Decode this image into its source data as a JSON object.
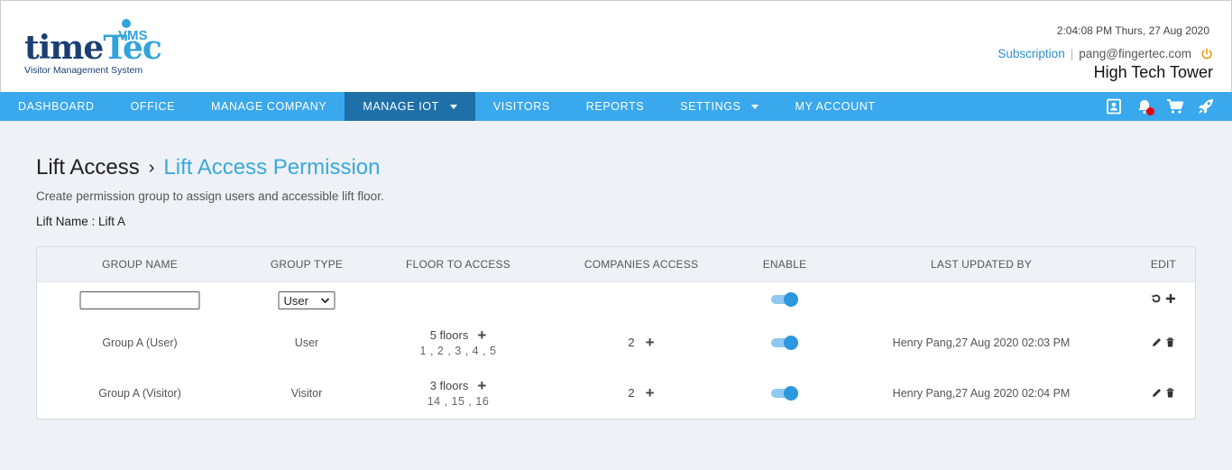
{
  "logo": {
    "brand_time": "time",
    "brand_tec": "Tec",
    "brand_vms": "VMS",
    "subtitle": "Visitor Management System"
  },
  "header": {
    "datetime": "2:04:08 PM  Thurs, 27 Aug 2020",
    "subscription": "Subscription",
    "separator": "|",
    "email": "pang@fingertec.com",
    "site": "High Tech Tower"
  },
  "nav": {
    "items": [
      {
        "label": "DASHBOARD"
      },
      {
        "label": "OFFICE"
      },
      {
        "label": "MANAGE COMPANY"
      },
      {
        "label": "MANAGE IOT"
      },
      {
        "label": "VISITORS"
      },
      {
        "label": "REPORTS"
      },
      {
        "label": "SETTINGS"
      },
      {
        "label": "MY ACCOUNT"
      }
    ],
    "active": "MANAGE IOT",
    "icons": [
      "contact-card-icon",
      "notification-bell-icon",
      "cart-icon",
      "rocket-icon"
    ]
  },
  "page": {
    "breadcrumb_parent": "Lift Access",
    "breadcrumb_sep": "›",
    "breadcrumb_current": "Lift Access Permission",
    "description": "Create permission group to assign users and accessible lift floor.",
    "lift_name": "Lift Name : Lift A"
  },
  "table": {
    "headers": [
      "GROUP NAME",
      "GROUP TYPE",
      "FLOOR TO ACCESS",
      "COMPANIES ACCESS",
      "ENABLE",
      "LAST UPDATED BY",
      "EDIT"
    ],
    "new_row": {
      "group_name": "",
      "group_type": "User",
      "enabled": true
    },
    "rows": [
      {
        "group_name": "Group A (User)",
        "group_type": "User",
        "floors_count": "5 floors",
        "floors_list": "1 , 2 , 3 , 4 , 5",
        "companies": "2",
        "enabled": true,
        "last_updated": "Henry Pang,27 Aug 2020 02:03 PM"
      },
      {
        "group_name": "Group A (Visitor)",
        "group_type": "Visitor",
        "floors_count": "3 floors",
        "floors_list": "14 , 15 , 16",
        "companies": "2",
        "enabled": true,
        "last_updated": "Henry Pang,27 Aug 2020 02:04 PM"
      }
    ]
  },
  "colors": {
    "nav_bg": "#3aa8ec",
    "nav_active": "#1f6fa8",
    "accent": "#3aa8dc",
    "toggle": "#2a97de"
  }
}
